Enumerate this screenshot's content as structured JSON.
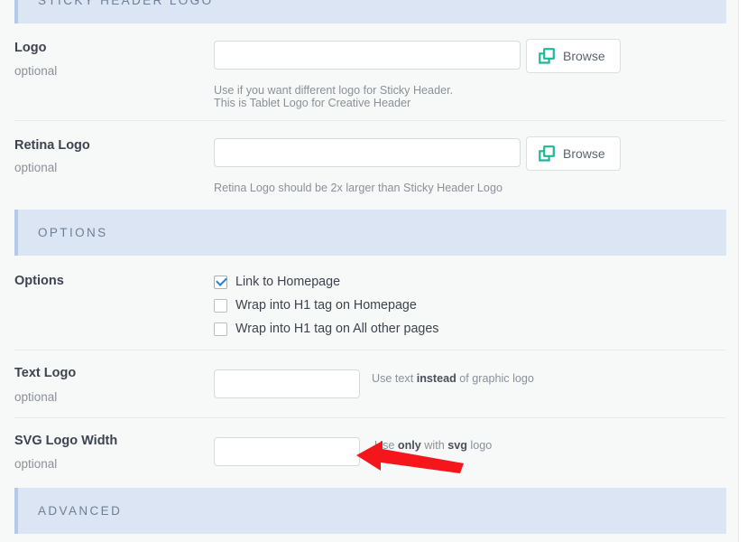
{
  "sections": [
    {
      "id": "sticky-header-logo",
      "title": "STICKY HEADER LOGO"
    },
    {
      "id": "options",
      "title": "OPTIONS"
    },
    {
      "id": "advanced",
      "title": "ADVANCED"
    }
  ],
  "fields": {
    "logo": {
      "label": "Logo",
      "optional": "optional",
      "value": "",
      "placeholder": "",
      "browse_label": "Browse",
      "browse_icon": "clone-icon",
      "help_line1": "Use if you want different logo for Sticky Header.",
      "help_line2": "This is Tablet Logo for Creative Header"
    },
    "retina_logo": {
      "label": "Retina Logo",
      "optional": "optional",
      "value": "",
      "placeholder": "",
      "browse_label": "Browse",
      "browse_icon": "clone-icon",
      "help_line1": "Retina Logo should be 2x larger than Sticky Header Logo"
    },
    "options": {
      "label": "Options",
      "items": [
        {
          "label": "Link to Homepage",
          "checked": true
        },
        {
          "label": "Wrap into H1 tag on Homepage",
          "checked": false
        },
        {
          "label": "Wrap into H1 tag on All other pages",
          "checked": false
        }
      ]
    },
    "text_logo": {
      "label": "Text Logo",
      "optional": "optional",
      "value": "",
      "placeholder": "",
      "help_pre": "Use text ",
      "help_strong": "instead",
      "help_post": " of graphic logo"
    },
    "svg_logo_width": {
      "label": "SVG Logo Width",
      "optional": "optional",
      "value": "",
      "placeholder": "",
      "help_pre": "Use ",
      "help_strong": "only",
      "help_mid": " with ",
      "help_strong2": "svg",
      "help_post": " logo"
    }
  },
  "annotation": {
    "type": "arrow",
    "color": "#f5161b",
    "direction": "left",
    "points_to": "svg-logo-width-input"
  },
  "colors": {
    "section_header_bg": "#dbe5f4",
    "section_header_accent": "#b6c9e6",
    "section_header_text": "#6d7f96",
    "page_bg": "#f7f8f8",
    "label_text": "#3d4450",
    "muted_text": "#8b9099",
    "checkbox_check": "#2a7fc4",
    "browse_icon": "#1fb698",
    "arrow": "#f5161b"
  }
}
